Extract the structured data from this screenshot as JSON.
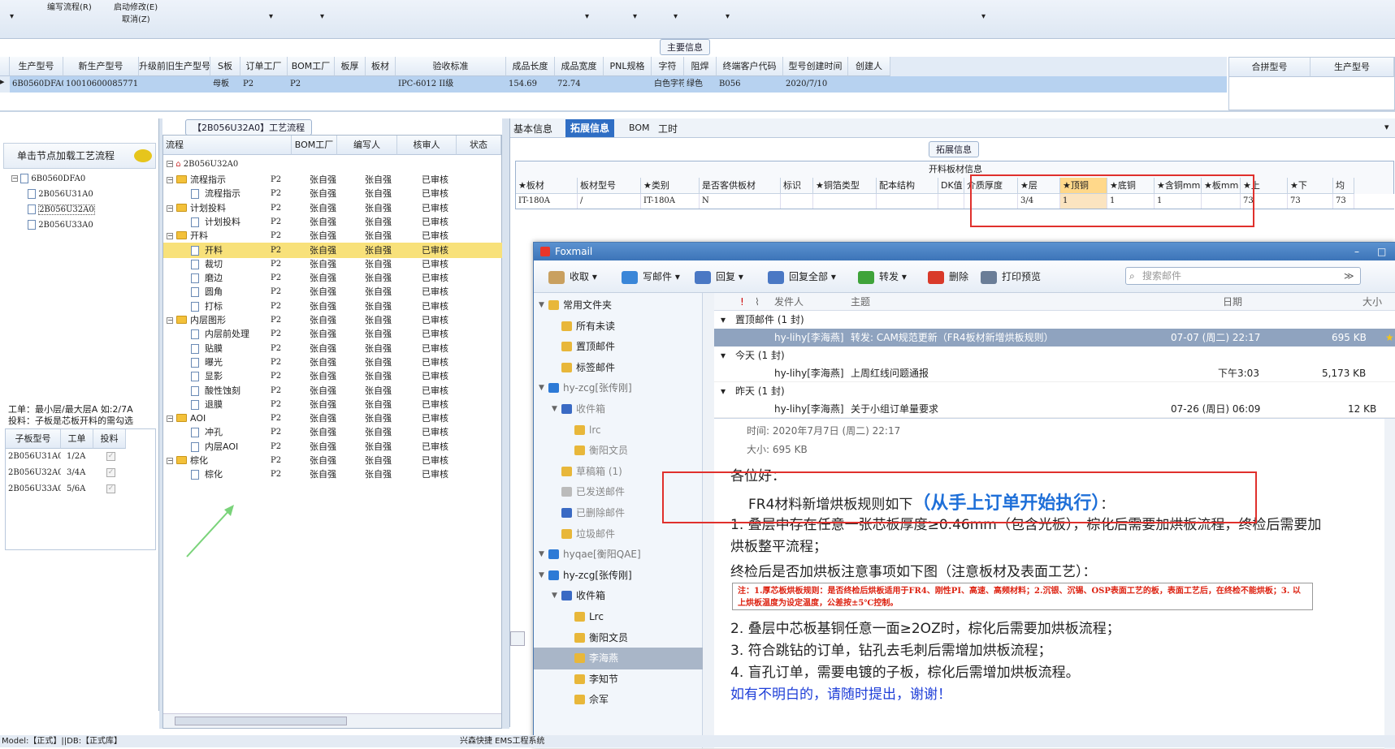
{
  "toolbar": {
    "items": [
      "编写流程(R)",
      "启动修改(E)",
      "取消(Z)"
    ]
  },
  "main_info": {
    "section_title": "主要信息",
    "columns": [
      "生产型号",
      "新生产型号",
      "升级前旧生产型号",
      "S板",
      "订单工厂",
      "BOM工厂",
      "板厚",
      "板材",
      "验收标准",
      "成品长度",
      "成品宽度",
      "PNL规格",
      "字符",
      "阻焊",
      "终端客户代码",
      "型号创建时间",
      "创建人"
    ],
    "row": [
      "6B0560DFA0",
      "10010600085771",
      "",
      "母板",
      "P2",
      "P2",
      "",
      "",
      "IPC-6012 II级",
      "154.69",
      "72.74",
      "",
      "白色字符",
      "绿色",
      "B056",
      "2020/7/10",
      ""
    ],
    "right_columns": [
      "合拼型号",
      "生产型号"
    ]
  },
  "left": {
    "load_button": "单击节点加载工艺流程",
    "tree": [
      "6B0560DFA0",
      "2B056U31A0",
      "2B056U32A0",
      "2B056U33A0"
    ],
    "hint1": "工单：最小层/最大层A 如:2/7A",
    "hint2": "投料：子板是芯板开料的需勾选",
    "sub_columns": [
      "子板型号",
      "工单",
      "投料"
    ],
    "sub_rows": [
      [
        "2B056U31A0",
        "1/2A"
      ],
      [
        "2B056U32A0",
        "3/4A"
      ],
      [
        "2B056U33A0",
        "5/6A"
      ]
    ]
  },
  "process": {
    "title": "【2B056U32A0】工艺流程",
    "columns": [
      "流程",
      "BOM工厂",
      "编写人",
      "核审人",
      "状态"
    ],
    "root": "2B056U32A0",
    "rows": [
      {
        "name": "流程指示",
        "type": "folder",
        "lvl": 1
      },
      {
        "name": "流程指示",
        "type": "doc",
        "lvl": 2
      },
      {
        "name": "计划投料",
        "type": "folder",
        "lvl": 1
      },
      {
        "name": "计划投料",
        "type": "doc",
        "lvl": 2
      },
      {
        "name": "开料",
        "type": "folder",
        "lvl": 1
      },
      {
        "name": "开料",
        "type": "doc",
        "lvl": 2,
        "sel": true
      },
      {
        "name": "裁切",
        "type": "doc",
        "lvl": 2
      },
      {
        "name": "磨边",
        "type": "doc",
        "lvl": 2
      },
      {
        "name": "圆角",
        "type": "doc",
        "lvl": 2
      },
      {
        "name": "打标",
        "type": "doc",
        "lvl": 2
      },
      {
        "name": "内层图形",
        "type": "folder",
        "lvl": 1
      },
      {
        "name": "内层前处理",
        "type": "doc",
        "lvl": 2
      },
      {
        "name": "贴膜",
        "type": "doc",
        "lvl": 2
      },
      {
        "name": "曝光",
        "type": "doc",
        "lvl": 2
      },
      {
        "name": "显影",
        "type": "doc",
        "lvl": 2
      },
      {
        "name": "酸性蚀刻",
        "type": "doc",
        "lvl": 2
      },
      {
        "name": "退膜",
        "type": "doc",
        "lvl": 2
      },
      {
        "name": "AOI",
        "type": "folder",
        "lvl": 1
      },
      {
        "name": "冲孔",
        "type": "doc",
        "lvl": 2
      },
      {
        "name": "内层AOI",
        "type": "doc",
        "lvl": 2
      },
      {
        "name": "棕化",
        "type": "folder",
        "lvl": 1
      },
      {
        "name": "棕化",
        "type": "doc",
        "lvl": 2
      }
    ],
    "factory": "P2",
    "writer": "张自强",
    "reviewer": "张自强",
    "status": "已审核"
  },
  "tabs": [
    "基本信息",
    "拓展信息",
    "BOM",
    "工时"
  ],
  "ext": {
    "section_title": "拓展信息",
    "table_title": "开料板材信息",
    "columns": [
      "★板材",
      "板材型号",
      "★类别",
      "是否客供板材",
      "标识",
      "★铜箔类型",
      "配本结构",
      "DK值",
      "介质厚度",
      "★层",
      "★顶铜",
      "★底铜",
      "★含铜mm",
      "★板mm",
      "★上",
      "★下",
      "均"
    ],
    "row": [
      "IT-180A",
      "/",
      "IT-180A",
      "N",
      "",
      "",
      "",
      "",
      "",
      "3/4",
      "1",
      "1",
      "1",
      "",
      "73",
      "73",
      "73"
    ]
  },
  "foxmail": {
    "title": "Foxmail",
    "toolbar": [
      "收取",
      "写邮件",
      "回复",
      "回复全部",
      "转发",
      "删除",
      "打印预览"
    ],
    "search_placeholder": "搜索邮件",
    "folders": [
      "常用文件夹",
      "所有未读",
      "置顶邮件",
      "标签邮件",
      "hy-zcg[张传刚]",
      "收件箱",
      "lrc",
      "衡阳文员",
      "草稿箱 (1)",
      "已发送邮件",
      "已删除邮件",
      "垃圾邮件",
      "hyqae[衡阳QAE]",
      "hy-zcg[张传刚]",
      "收件箱",
      "Lrc",
      "衡阳文员",
      "李海燕",
      "李知节",
      "佘军"
    ],
    "list_headers": {
      "sender": "发件人",
      "subject": "主题",
      "date": "日期",
      "size": "大小"
    },
    "groups": [
      "置顶邮件 (1 封)",
      "今天 (1 封)",
      "昨天 (1 封)"
    ],
    "mails": [
      {
        "sender": "hy-lihy[李海燕]",
        "subject": "转发: CAM规范更新（FR4板材新增烘板规则）",
        "date": "07-07 (周二) 22:17",
        "size": "695 KB"
      },
      {
        "sender": "hy-lihy[李海燕]",
        "subject": "上周红线问题通报",
        "date": "下午3:03",
        "size": "5,173 KB"
      },
      {
        "sender": "hy-lihy[李海燕]",
        "subject": "关于小组订单量要求",
        "date": "07-26 (周日) 06:09",
        "size": "12 KB"
      }
    ],
    "body": {
      "time": "时间: 2020年7月7日 (周二) 22:17",
      "size": "大小: 695 KB",
      "greeting": "各位好：",
      "line1a": "FR4材料新增烘板规则如下",
      "line1b": "（从手上订单开始执行）",
      "line1c": "：",
      "line2": "1. 叠层中存在任意一张芯板厚度≥0.46mm（包含光板），棕化后需要加烘板流程，终检后需要加烘板整平流程；",
      "line3": "终检后是否加烘板注意事项如下图（注意板材及表面工艺）：",
      "note": "注：1.厚芯板烘板规则：是否终检后烘板适用于FR4、刚性PI、高速、高频材料；2.沉银、沉锡、OSP表面工艺的板，表面工艺后，在终检不能烘板；3. 以上烘板温度为设定温度，公差按±5℃控制。",
      "line4": "2. 叠层中芯板基铜任意一面≥2OZ时，棕化后需要加烘板流程；",
      "line5": "3. 符合跳钻的订单，钻孔去毛刺后需增加烘板流程；",
      "line6": "4. 盲孔订单，需要电镀的子板，棕化后需增加烘板流程。",
      "line7": "如有不明白的，请随时提出，谢谢！"
    }
  },
  "status": {
    "left": "Model:【正式】||DB:【正式库】",
    "right": "兴森快捷 EMS工程系统"
  }
}
